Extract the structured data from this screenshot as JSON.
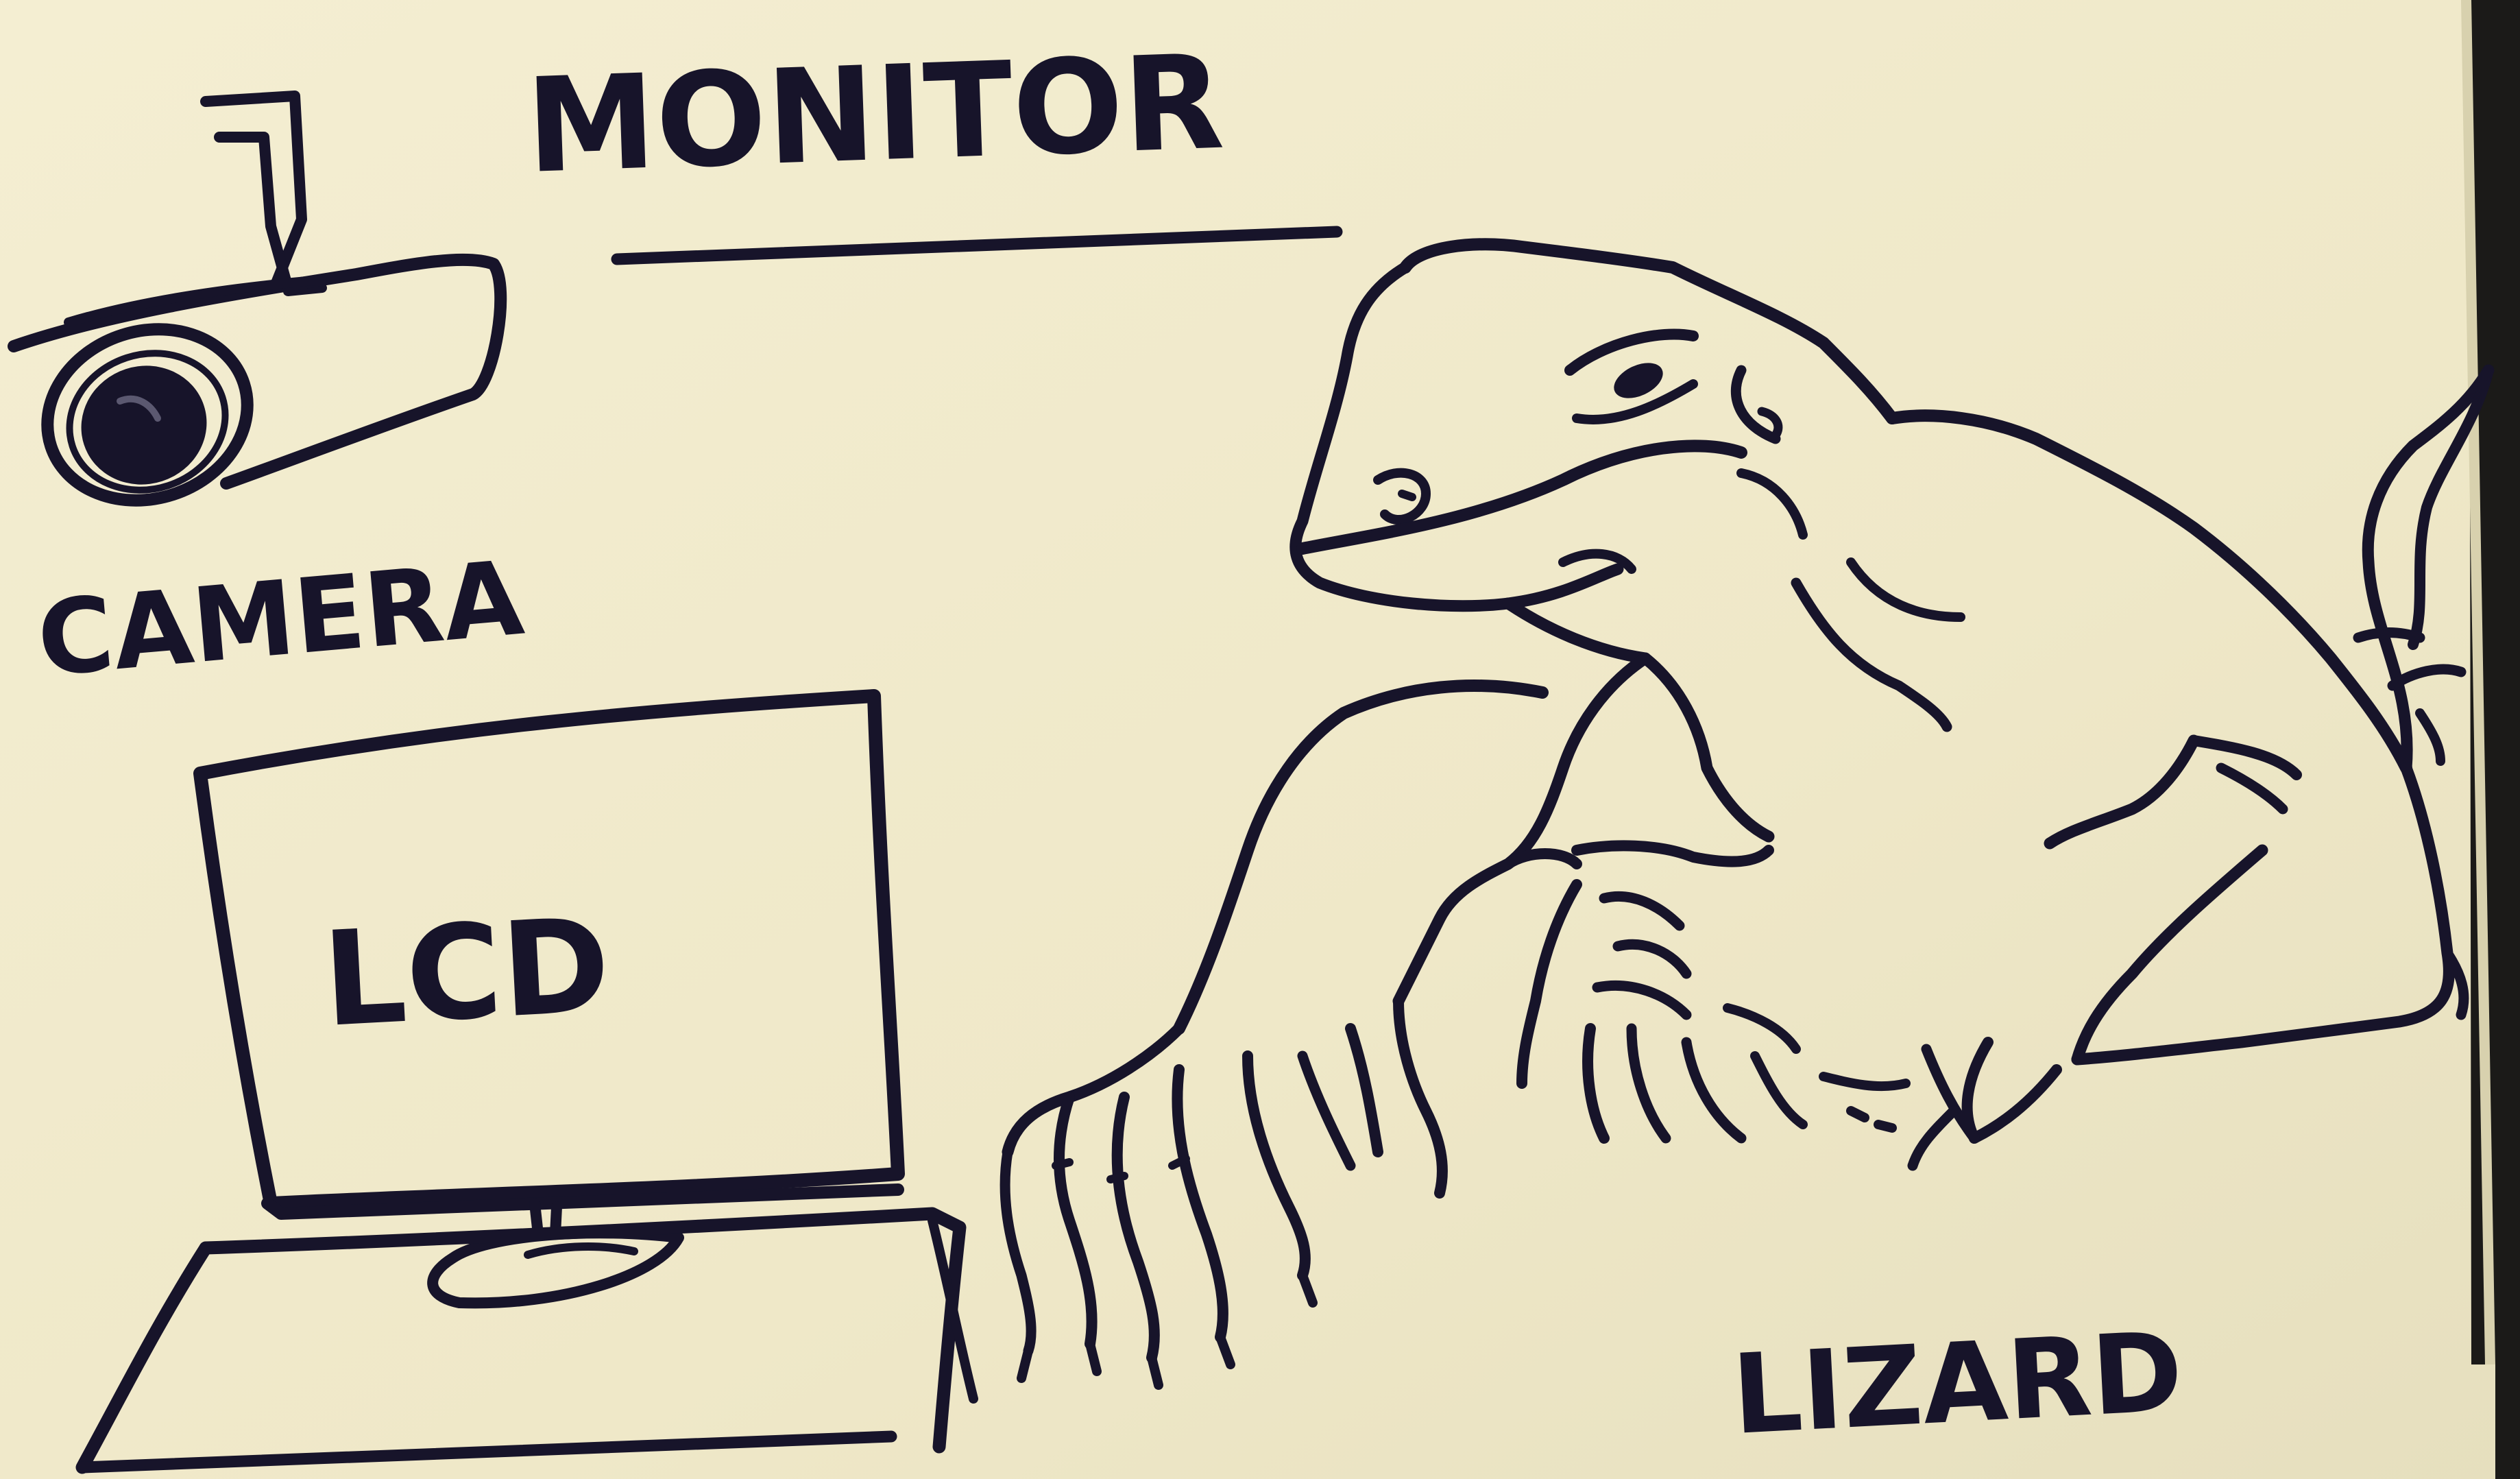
{
  "labels": {
    "title": "MONITOR",
    "camera": "CAMERA",
    "screen": "LCD",
    "animal": "LIZARD"
  },
  "colors": {
    "paper": "#f1ebcc",
    "ink": "#17142a",
    "table_edge": "#1b1a18"
  },
  "icons": {
    "camera": "security-camera-icon",
    "monitor": "lcd-monitor-icon",
    "animal": "lizard-icon"
  }
}
